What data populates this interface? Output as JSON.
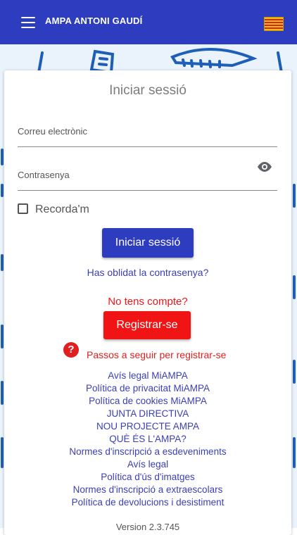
{
  "appbar": {
    "title": "AMPA ANTONI GAUDÍ",
    "flag": "catalan-flag-icon"
  },
  "login": {
    "title": "Iniciar sessió",
    "email_label": "Correu electrònic",
    "email_value": "",
    "password_label": "Contrasenya",
    "password_value": "",
    "remember_label": "Recorda'm",
    "remember_checked": false,
    "login_button": "Iniciar sessió",
    "forgot_password": "Has oblidat la contrasenya?",
    "no_account": "No tens compte?",
    "register_button": "Registrar-se",
    "steps_icon": "?",
    "steps_text": "Passos a seguir per registrar-se"
  },
  "links": [
    "Avís legal MiAMPA",
    "Política de privacitat MiAMPA",
    "Política de cookies MiAMPA",
    "JUNTA DIRECTIVA",
    "NOU PROJECTE AMPA",
    "QUÈ ÉS L'AMPA?",
    "Normes d'inscripció a esdeveniments",
    "Avís legal",
    "Política d'ús d'imatges",
    "Normes d'inscripció a extraescolars",
    "Política de devolucions i desistiment"
  ],
  "version": "Version 2.3.745",
  "colors": {
    "primary": "#2e3dbf",
    "danger": "#f01414",
    "link": "#3b3fb5"
  }
}
